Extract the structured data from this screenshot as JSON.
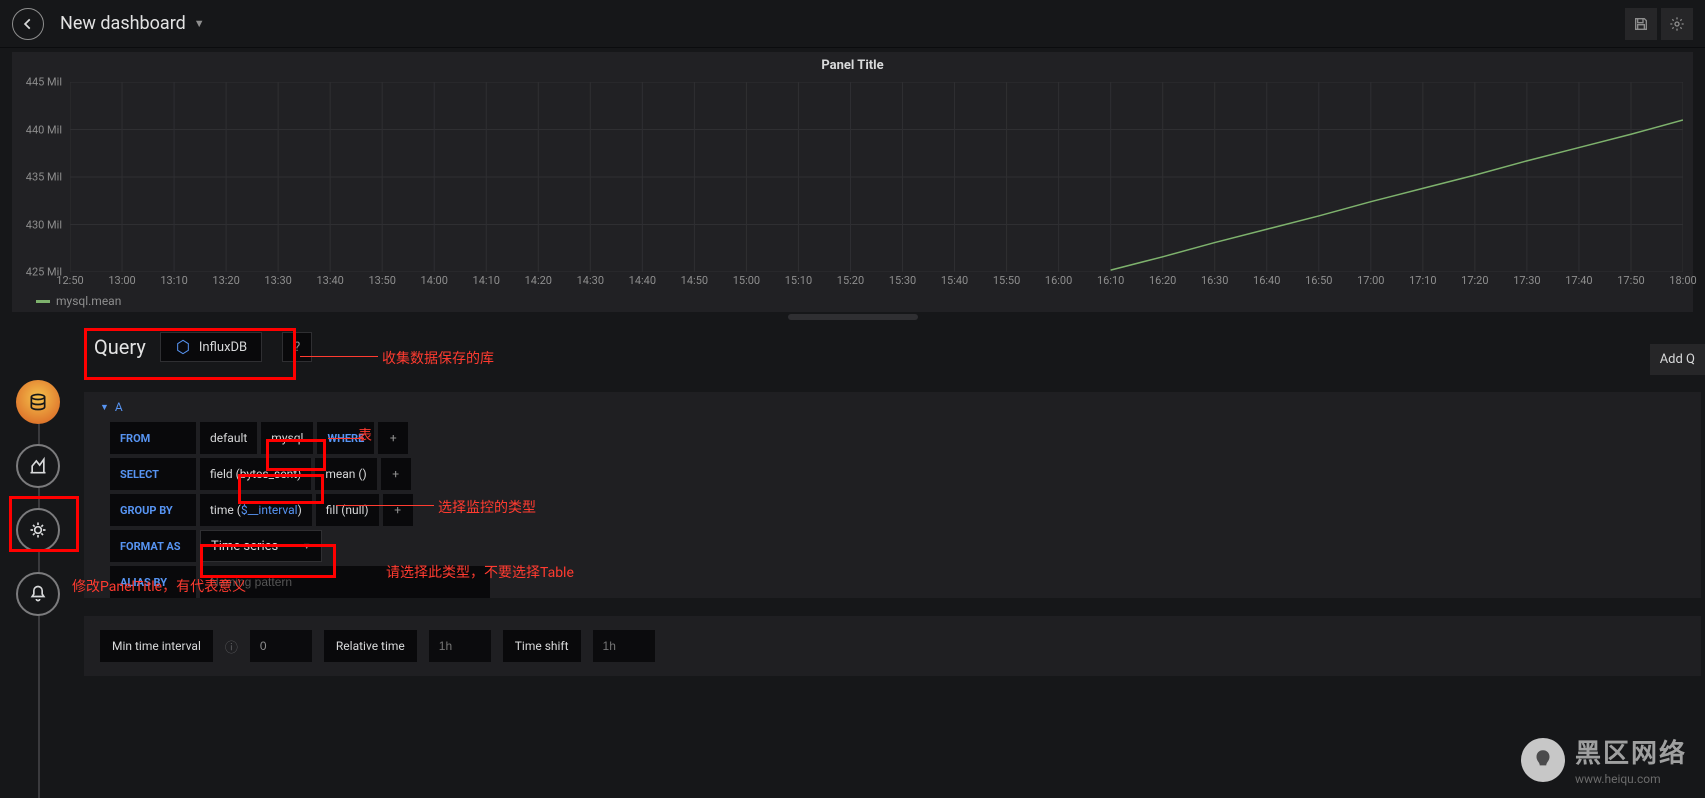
{
  "header": {
    "title": "New dashboard"
  },
  "panel": {
    "title": "Panel Title",
    "legend": "mysql.mean"
  },
  "chart_data": {
    "type": "line",
    "title": "Panel Title",
    "xlabel": "",
    "ylabel": "",
    "ylim": [
      425,
      445
    ],
    "ytick_suffix": " Mil",
    "yticks": [
      425,
      430,
      435,
      440,
      445
    ],
    "x_categories": [
      "12:50",
      "13:00",
      "13:10",
      "13:20",
      "13:30",
      "13:40",
      "13:50",
      "14:00",
      "14:10",
      "14:20",
      "14:30",
      "14:40",
      "14:50",
      "15:00",
      "15:10",
      "15:20",
      "15:30",
      "15:40",
      "15:50",
      "16:00",
      "16:10",
      "16:20",
      "16:30",
      "16:40",
      "16:50",
      "17:00",
      "17:10",
      "17:20",
      "17:30",
      "17:40",
      "17:50",
      "18:00"
    ],
    "series": [
      {
        "name": "mysql.mean",
        "color": "#7eb26d",
        "x": [
          "16:10",
          "16:20",
          "16:30",
          "16:40",
          "16:50",
          "17:00",
          "17:10",
          "17:20",
          "17:30",
          "17:40",
          "17:50",
          "18:00"
        ],
        "values": [
          425.2,
          426.6,
          428.1,
          429.5,
          430.9,
          432.4,
          433.8,
          435.2,
          436.7,
          438.1,
          439.5,
          441.0
        ]
      }
    ]
  },
  "editor": {
    "tab_label": "Query",
    "datasource": "InfluxDB",
    "add_query": "Add Q",
    "query_letter": "A",
    "from_label": "FROM",
    "from_default": "default",
    "from_table": "mysql",
    "where_label": "WHERE",
    "select_label": "SELECT",
    "select_field": "field (bytes_sent)",
    "select_agg": "mean ()",
    "group_label": "GROUP BY",
    "group_time_prefix": "time (",
    "group_time_var": "$__interval",
    "group_time_suffix": ")",
    "group_fill": "fill (null)",
    "format_label": "FORMAT AS",
    "format_value": "Time series",
    "alias_label": "ALIAS BY",
    "alias_placeholder": "Naming pattern",
    "time_min_label": "Min time interval",
    "time_min_value": "0",
    "time_rel_label": "Relative time",
    "time_rel_placeholder": "1h",
    "time_shift_label": "Time shift",
    "time_shift_placeholder": "1h"
  },
  "annotations": {
    "a1": "收集数据保存的库",
    "a2": "表",
    "a3": "选择监控的类型",
    "a4": "请选择此类型，不要选择Table",
    "a5": "修改PanelTitle，有代表意义"
  },
  "watermark": {
    "brand": "黑区网络",
    "site": "www.heiqu.com"
  }
}
